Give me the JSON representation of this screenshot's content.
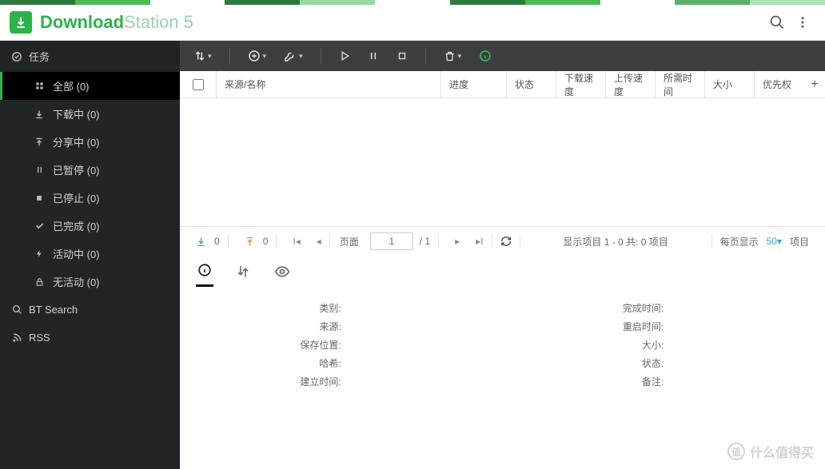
{
  "app": {
    "titleBold": "Download",
    "titleLight": "Station 5"
  },
  "colors": {
    "accent": "#2cb34a"
  },
  "tabstrip": [
    "#2d7a3f",
    "#4fb858",
    "#ffffff",
    "#2d7a3f",
    "#97d9a0",
    "#ffffff",
    "#2d7a3f",
    "#4fb858",
    "#ffffff",
    "#5bb06a",
    "#b0e2b8"
  ],
  "sidebar": {
    "tasks": "任务",
    "items": [
      {
        "icon": "grid",
        "label": "全部 (0)"
      },
      {
        "icon": "down",
        "label": "下载中 (0)"
      },
      {
        "icon": "up",
        "label": "分享中 (0)"
      },
      {
        "icon": "pause",
        "label": "已暂停 (0)"
      },
      {
        "icon": "stop",
        "label": "已停止 (0)"
      },
      {
        "icon": "check",
        "label": "已完成 (0)"
      },
      {
        "icon": "bolt",
        "label": "活动中 (0)"
      },
      {
        "icon": "lock",
        "label": "无活动 (0)"
      }
    ],
    "bt": "BT Search",
    "rss": "RSS"
  },
  "table": {
    "cols": [
      "来源/名称",
      "进度",
      "状态",
      "下载速度",
      "上传速度",
      "所需时间",
      "大小",
      "优先权"
    ]
  },
  "pager": {
    "downCount": "0",
    "upCount": "0",
    "pageLabel": "页面",
    "pageValue": "1",
    "pageTotal": "/ 1",
    "range": "显示项目 1 - 0 共: 0 项目",
    "perPageLabel": "每页显示",
    "perPageValue": "50",
    "perPageUnit": "项目"
  },
  "details": {
    "left": [
      "类别:",
      "来源:",
      "保存位置:",
      "哈希:",
      "建立时间:"
    ],
    "right": [
      "完成时间:",
      "重启时间:",
      "大小:",
      "状态:",
      "备注:"
    ]
  },
  "watermark": "什么值得买"
}
